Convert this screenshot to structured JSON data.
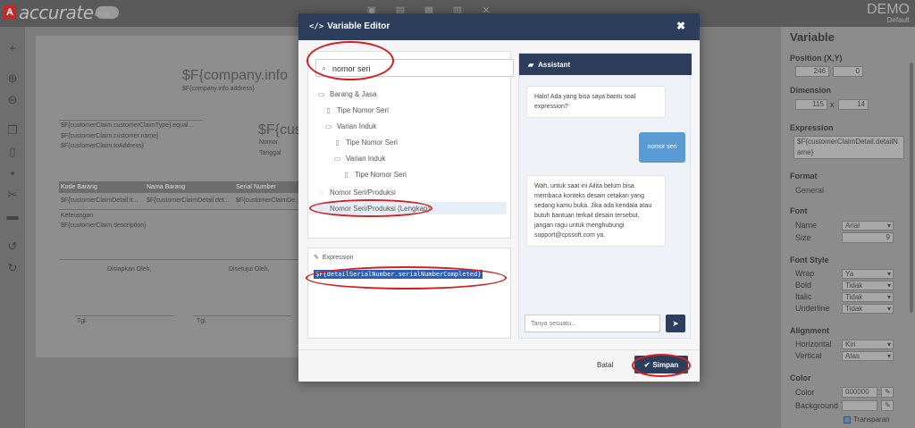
{
  "app": {
    "logo_text": "accurate",
    "logo_sub": "online",
    "demo_label": "DEMO",
    "default_label": "Default"
  },
  "canvas": {
    "company_title": "$F{company.info",
    "company_address": "$F{company.info.address}",
    "claim_type": "$F{customerClaim.customerClaimType}.equal...",
    "customer_name": "$F{customerClaim.customer.name}",
    "to_address": "$F{customerClaim.toAddress}",
    "cus_title": "$F{cus",
    "nomor": "Nomor",
    "tanggal": "Tanggal",
    "col_kode": "Kode Barang",
    "col_nama": "Nama Barang",
    "col_serial": "Serial Number",
    "detail_1": "$F{customerClaimDetail.it...",
    "detail_2": "$F{customerClaimDetail.det...",
    "detail_3": "$F{customerClaimDe...",
    "keterangan": "Keterangan",
    "description": "$F{customerClaim.description}",
    "disiapkan": "Disiapkan Oleh,",
    "disetujui": "Disetujui Oleh,",
    "tgl1": "Tgl.",
    "tgl2": "Tgl."
  },
  "modal": {
    "title": "Variable Editor",
    "close_glyph": "✖",
    "search_value": "nomor seri",
    "tree": [
      {
        "label": "Barang & Jasa",
        "icon": "folder-icon"
      },
      {
        "label": "Tipe Nomor Seri",
        "icon": "file-icon"
      },
      {
        "label": "Varian Induk",
        "icon": "folder-icon"
      },
      {
        "label": "Tipe Nomor Seri",
        "icon": "file-icon"
      },
      {
        "label": "Varian Induk",
        "icon": "folder-icon"
      },
      {
        "label": "Tipe Nomor Seri",
        "icon": "file-icon"
      },
      {
        "label": "Nomor Seri/Produksi",
        "icon": "comment-icon"
      },
      {
        "label": "Nomor Seri/Produksi (Lengkap)",
        "icon": "comment-icon"
      }
    ],
    "expression_label": "Expression",
    "expression_value": "$F{detailSerialNumber.serialNumberCompleted}",
    "assistant_title": "Assistant",
    "messages": {
      "greeting": "Halo! Ada yang bisa saya bantu soal expression?",
      "user": "nomor seri",
      "reply": "Wah, untuk saat ini Ailita belum bisa membaca konteks desain cetakan yang sedang kamu buka. Jika ada kendala atau butuh bantuan terkait desain tersebut, jangan ragu untuk menghubungi support@cpssoft.com ya."
    },
    "chat_placeholder": "Tanya sesuatu...",
    "cancel_label": "Batal",
    "save_label": "Simpan"
  },
  "properties": {
    "title": "Variable",
    "position_label": "Position (X,Y)",
    "pos_x": "246",
    "pos_y": "0",
    "dimension_label": "Dimension",
    "dim_w": "115",
    "dim_x": "x",
    "dim_h": "14",
    "expression_label": "Expression",
    "expression_value": "$F{customerClaimDetail.detailName}",
    "format_label": "Format",
    "format_value": "General",
    "font_label": "Font",
    "name_label": "Name",
    "name_value": "Arial",
    "size_label": "Size",
    "size_value": "9",
    "fontstyle_label": "Font Style",
    "wrap_label": "Wrap",
    "wrap_value": "Ya",
    "bold_label": "Bold",
    "bold_value": "Tidak",
    "italic_label": "Italic",
    "italic_value": "Tidak",
    "underline_label": "Underline",
    "underline_value": "Tidak",
    "alignment_label": "Alignment",
    "horizontal_label": "Horizontal",
    "horizontal_value": "Kiri",
    "vertical_label": "Vertical",
    "vertical_value": "Atas",
    "color_label": "Color",
    "color_sub_label": "Color",
    "color_value": "000000",
    "background_label": "Background",
    "transparent_label": "Transparan"
  },
  "colors": {
    "header": "#2c3e5c",
    "annotation": "#d42020",
    "selection": "#2b5fb4"
  }
}
